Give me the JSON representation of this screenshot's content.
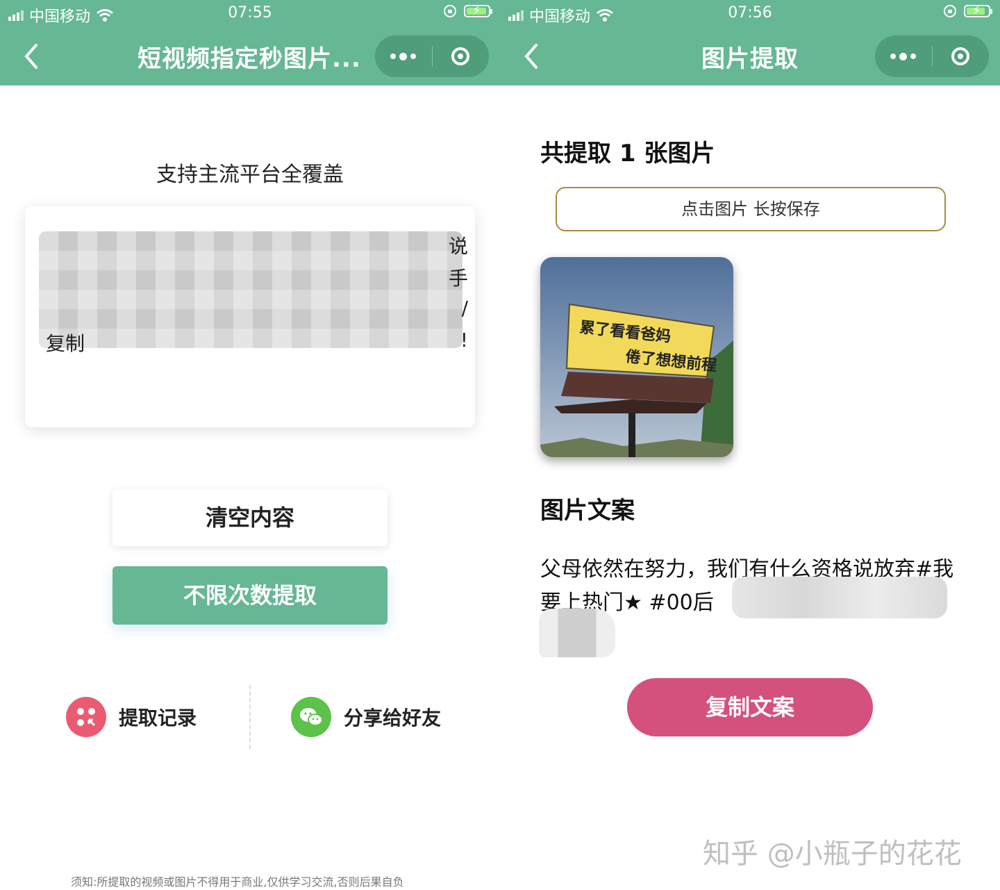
{
  "left": {
    "status": {
      "carrier": "中国移动",
      "time": "07:55"
    },
    "nav": {
      "title": "短视频指定秒图片..."
    },
    "support_text": "支持主流平台全覆盖",
    "input_visible_fragments": [
      "说",
      "手",
      "/",
      "复制",
      "!"
    ],
    "clear_label": "清空内容",
    "extract_label": "不限次数提取",
    "records_label": "提取记录",
    "share_label": "分享给好友",
    "notice": "须知:所提取的视频或图片不得用于商业,仅供学习交流,否则后果自负"
  },
  "right": {
    "status": {
      "carrier": "中国移动",
      "time": "07:56"
    },
    "nav": {
      "title": "图片提取"
    },
    "count_label": "共提取 1 张图片",
    "save_hint": "点击图片 长按保存",
    "image": {
      "line1": "累了看看爸妈",
      "line2": "倦了想想前程"
    },
    "copy_heading": "图片文案",
    "copy_text": "父母依然在努力，我们有什么资格说放弃#我要上热门★ #00后",
    "copy_button": "复制文案",
    "watermark": "知乎 @小瓶子的花花"
  },
  "colors": {
    "header": "#66b794",
    "capsule": "#4f9d79",
    "copy_button": "#d5517d",
    "records_icon": "#ea5b72",
    "share_icon": "#5cc249"
  }
}
